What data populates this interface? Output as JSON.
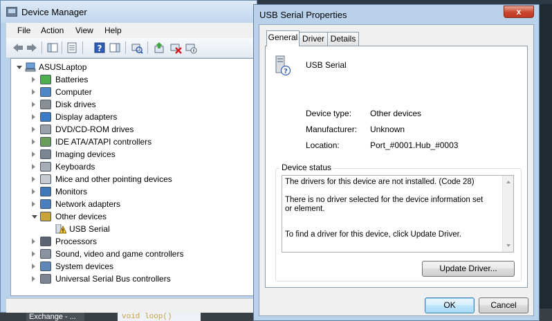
{
  "device_manager": {
    "title": "Device Manager",
    "menu": [
      "File",
      "Action",
      "View",
      "Help"
    ],
    "toolbar_icons": [
      "back-icon",
      "forward-icon",
      "show-hide-console-tree-icon",
      "properties-icon",
      "help-icon",
      "show-hide-action-pane-icon",
      "scan-hardware-changes-icon",
      "update-driver-icon",
      "uninstall-icon",
      "disable-icon"
    ],
    "tree": {
      "root": "ASUSLaptop",
      "categories": [
        {
          "label": "Batteries",
          "icon": "battery-icon",
          "expanded": false
        },
        {
          "label": "Computer",
          "icon": "computer-icon",
          "expanded": false
        },
        {
          "label": "Disk drives",
          "icon": "disk-drive-icon",
          "expanded": false
        },
        {
          "label": "Display adapters",
          "icon": "display-adapter-icon",
          "expanded": false
        },
        {
          "label": "DVD/CD-ROM drives",
          "icon": "dvd-drive-icon",
          "expanded": false
        },
        {
          "label": "IDE ATA/ATAPI controllers",
          "icon": "ide-controller-icon",
          "expanded": false
        },
        {
          "label": "Imaging devices",
          "icon": "camera-icon",
          "expanded": false
        },
        {
          "label": "Keyboards",
          "icon": "keyboard-icon",
          "expanded": false
        },
        {
          "label": "Mice and other pointing devices",
          "icon": "mouse-icon",
          "expanded": false
        },
        {
          "label": "Monitors",
          "icon": "monitor-icon",
          "expanded": false
        },
        {
          "label": "Network adapters",
          "icon": "network-adapter-icon",
          "expanded": false
        },
        {
          "label": "Other devices",
          "icon": "other-devices-icon",
          "expanded": true
        },
        {
          "label": "Processors",
          "icon": "processor-icon",
          "expanded": false
        },
        {
          "label": "Sound, video and game controllers",
          "icon": "sound-icon",
          "expanded": false
        },
        {
          "label": "System devices",
          "icon": "system-device-icon",
          "expanded": false
        },
        {
          "label": "Universal Serial Bus controllers",
          "icon": "usb-controller-icon",
          "expanded": false
        }
      ],
      "other_devices_children": [
        {
          "label": "USB Serial",
          "icon": "unknown-device-warning-icon"
        }
      ]
    }
  },
  "properties_dialog": {
    "title": "USB Serial Properties",
    "close_label": "x",
    "tabs": [
      {
        "label": "General",
        "active": true
      },
      {
        "label": "Driver",
        "active": false
      },
      {
        "label": "Details",
        "active": false
      }
    ],
    "device_name": "USB Serial",
    "properties": [
      {
        "label": "Device type:",
        "value": "Other devices"
      },
      {
        "label": "Manufacturer:",
        "value": "Unknown"
      },
      {
        "label": "Location:",
        "value": "Port_#0001.Hub_#0003"
      }
    ],
    "status_group_label": "Device status",
    "status_lines": [
      "The drivers for this device are not installed. (Code 28)",
      "There is no driver selected for the device information set or element.",
      "To find a driver for this device, click Update Driver."
    ],
    "update_driver_label": "Update Driver...",
    "ok_label": "OK",
    "cancel_label": "Cancel"
  },
  "background": {
    "taskbar_item": "Exchange - ...",
    "code_hint": "void loop()"
  }
}
